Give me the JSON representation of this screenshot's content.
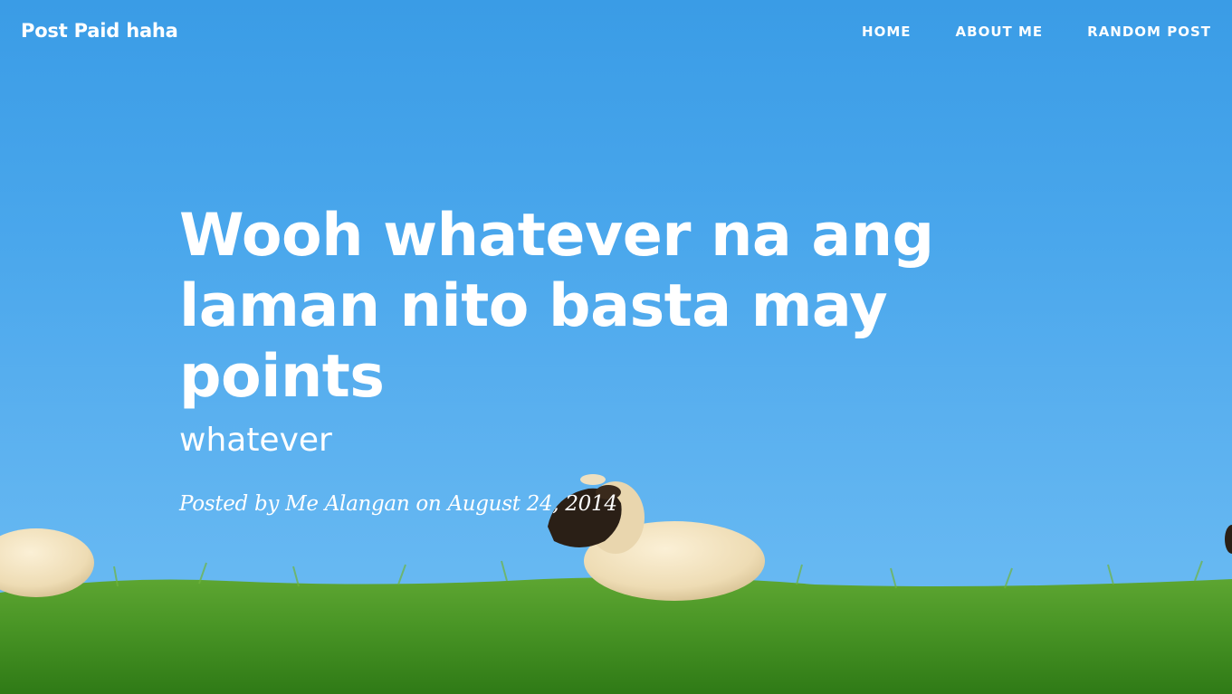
{
  "navbar": {
    "brand": "Post Paid haha",
    "links": [
      "Home",
      "About Me",
      "Random Post"
    ]
  },
  "post": {
    "title": "Wooh whatever na ang laman nito basta may points",
    "subtitle": "whatever",
    "meta_prefix": "Posted by",
    "author": "Me Alangan",
    "meta_on": "on",
    "date": "August 24, 2014"
  },
  "colors": {
    "sky": "#4aa7ec",
    "grass": "#3f8f1e",
    "text": "#ffffff"
  }
}
